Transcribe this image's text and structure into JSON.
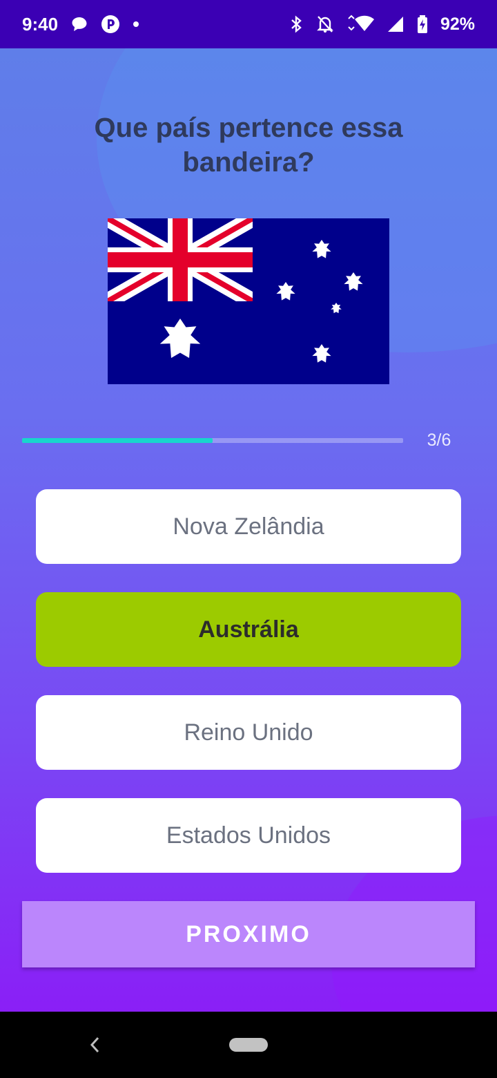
{
  "status_bar": {
    "time": "9:40",
    "battery": "92%",
    "icons": [
      "chat-bubble-icon",
      "app-p-icon",
      "dot-icon",
      "bluetooth-icon",
      "bell-off-icon",
      "wifi-icon",
      "signal-icon",
      "battery-charging-icon"
    ]
  },
  "quiz": {
    "question": "Que país pertence essa bandeira?",
    "flag": "australia-flag",
    "progress": {
      "label": "3/6",
      "fraction": 0.5
    },
    "options": [
      {
        "label": "Nova Zelândia",
        "selected": false
      },
      {
        "label": "Austrália",
        "selected": true
      },
      {
        "label": "Reino Unido",
        "selected": false
      },
      {
        "label": "Estados Unidos",
        "selected": false
      }
    ],
    "next_label": "PROXIMO"
  },
  "colors": {
    "status_bar": "#3b00b4",
    "selected_option": "#9ccb00",
    "progress": "#18d6cc",
    "next_button": "#bb86fc"
  }
}
